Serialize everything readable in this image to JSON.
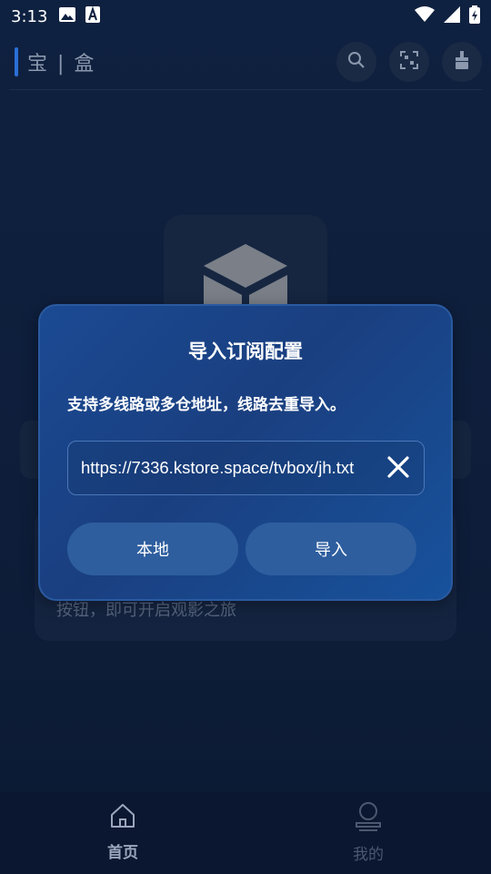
{
  "status_bar": {
    "time": "3:13",
    "left_icons": [
      "image-icon",
      "text-a-icon"
    ],
    "right_icons": [
      "wifi-icon",
      "signal-icon",
      "battery-icon"
    ]
  },
  "header": {
    "title": "宝 | 盒",
    "actions": [
      "search-icon",
      "scan-icon",
      "broom-icon"
    ]
  },
  "background": {
    "hint_text": "按钮，即可开启观影之旅"
  },
  "dialog": {
    "title": "导入订阅配置",
    "description": "支持多线路或多仓地址，线路去重导入。",
    "url_value": "https://7336.kstore.space/tvbox/jh.txt",
    "local_label": "本地",
    "import_label": "导入"
  },
  "bottom_nav": {
    "items": [
      {
        "label": "首页",
        "icon": "home-icon",
        "active": true
      },
      {
        "label": "我的",
        "icon": "profile-icon",
        "active": false
      }
    ]
  },
  "colors": {
    "dialog_bg": "#1b4a93",
    "button_bg": "#2e5e9e",
    "accent": "#2b6fd6"
  }
}
